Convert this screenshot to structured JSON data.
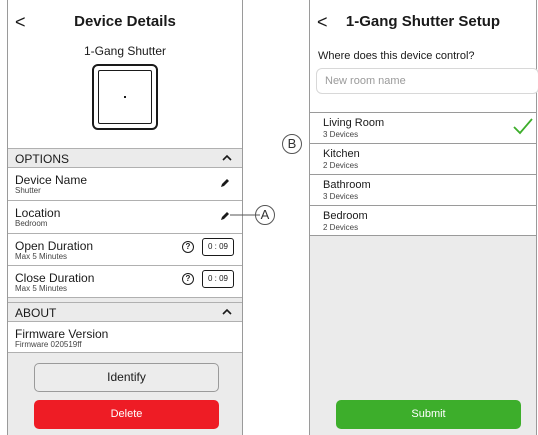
{
  "left": {
    "header": {
      "back": "<",
      "title": "Device Details"
    },
    "device_name": "1-Gang Shutter",
    "options_label": "OPTIONS",
    "rows": [
      {
        "title": "Device Name",
        "sub": "Shutter"
      },
      {
        "title": "Location",
        "sub": "Bedroom"
      },
      {
        "title": "Open Duration",
        "sub": "Max 5 Minutes",
        "value": "0 : 09"
      },
      {
        "title": "Close Duration",
        "sub": "Max 5 Minutes",
        "value": "0 : 09"
      }
    ],
    "help_glyph": "?",
    "about_label": "ABOUT",
    "firmware": {
      "title": "Firmware Version",
      "sub": "Firmware 020519ff"
    },
    "identify_label": "Identify",
    "delete_label": "Delete"
  },
  "right": {
    "header": {
      "back": "<",
      "title": "1-Gang Shutter Setup"
    },
    "question": "Where does this device control?",
    "input_placeholder": "New room name",
    "rooms": [
      {
        "name": "Living Room",
        "sub": "3 Devices",
        "selected": true
      },
      {
        "name": "Kitchen",
        "sub": "2 Devices",
        "selected": false
      },
      {
        "name": "Bathroom",
        "sub": "3 Devices",
        "selected": false
      },
      {
        "name": "Bedroom",
        "sub": "2 Devices",
        "selected": false
      }
    ],
    "submit_label": "Submit"
  },
  "callouts": {
    "a": "A",
    "b": "B"
  },
  "colors": {
    "delete": "#ee1c25",
    "submit": "#3dae2b",
    "check": "#3dae2b"
  },
  "icons": [
    "back-chevron-icon",
    "shutter-device-icon",
    "chevron-up-icon",
    "pencil-icon",
    "help-icon",
    "checkmark-icon"
  ]
}
